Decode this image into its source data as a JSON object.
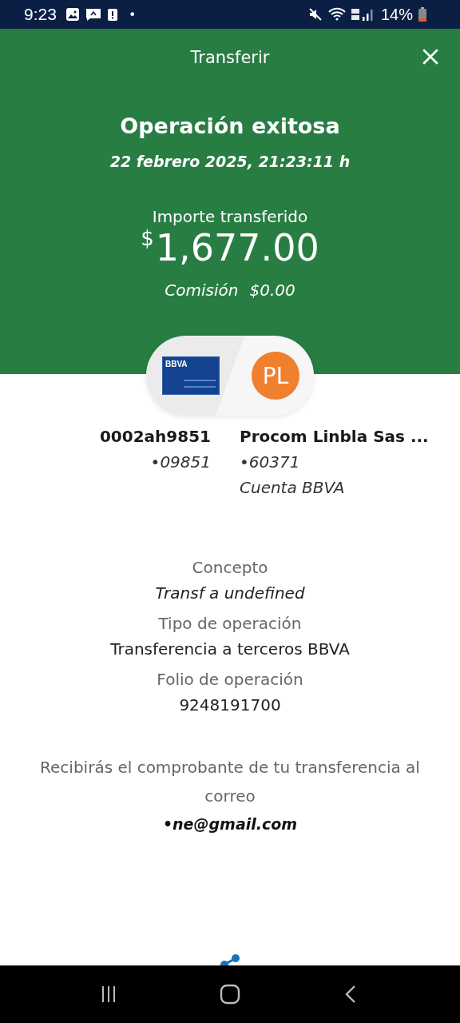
{
  "status_bar": {
    "time": "9:23",
    "battery": "14%",
    "notification_dot": "•"
  },
  "header": {
    "title": "Transferir"
  },
  "result": {
    "title": "Operación exitosa",
    "date": "22 febrero 2025, 21:23:11 h",
    "amount_label": "Importe transferido",
    "currency": "$",
    "amount": "1,677.00",
    "commission_label": "Comisión",
    "commission": "$0.00"
  },
  "origin": {
    "card_brand": "BBVA",
    "name": "0002ah9851",
    "number": "•09851"
  },
  "destination": {
    "initials": "PL",
    "name": "Procom Linbla Sas ...",
    "number": "•60371",
    "bank": "Cuenta BBVA"
  },
  "details": [
    {
      "label": "Concepto",
      "value": "Transf a undefined",
      "italic": true
    },
    {
      "label": "Tipo de operación",
      "value": "Transferencia a terceros BBVA",
      "italic": false
    },
    {
      "label": "Folio de operación",
      "value": "9248191700",
      "italic": false
    }
  ],
  "receipt": {
    "message": "Recibirás el comprobante de tu transferencia al correo",
    "email": "•ne@gmail.com"
  }
}
